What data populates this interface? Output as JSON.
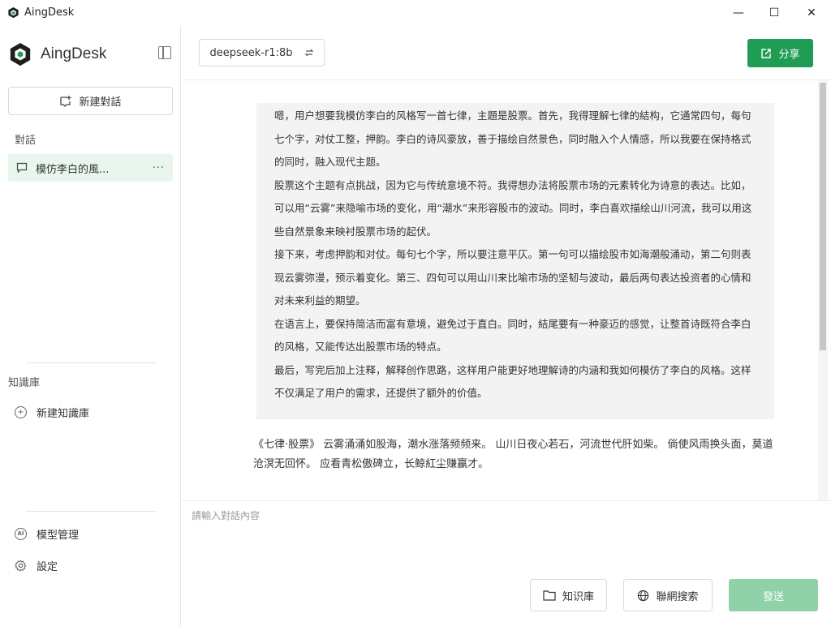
{
  "window": {
    "title": "AingDesk",
    "controls": {
      "minimize": "—",
      "maximize": "☐",
      "close": "✕"
    }
  },
  "sidebar": {
    "brand": "AingDesk",
    "new_chat_label": "新建對話",
    "conversations_label": "對話",
    "conversations": [
      {
        "label": "模仿李白的風...",
        "more": "···"
      }
    ],
    "knowledge_label": "知識庫",
    "new_knowledge_label": "新建知識庫",
    "model_management_label": "模型管理",
    "settings_label": "設定"
  },
  "header": {
    "model": "deepseek-r1:8b",
    "share_label": "分享"
  },
  "chat": {
    "thinking_paragraphs": [
      "嗯，用户想要我模仿李白的风格写一首七律，主題是股票。首先，我得理解七律的結构，它通常四句，每句七个字，对仗工整，押韵。李白的诗风豪放，善于描绘自然景色，同时融入个人情感，所以我要在保持格式的同时，融入现代主题。",
      "股票这个主题有点挑战，因为它与传统意境不符。我得想办法将股票市场的元素转化为诗意的表达。比如，可以用“云雾”来隐喻市场的变化，用“潮水”来形容股市的波动。同时，李白喜欢描绘山川河流，我可以用这些自然景象来映衬股票市场的起伏。",
      "接下来，考虑押韵和对仗。每句七个字，所以要注意平仄。第一句可以描绘股市如海潮般涌动，第二句则表现云雾弥漫，预示着变化。第三、四句可以用山川来比喻市场的坚韧与波动，最后两句表达投资者的心情和对未来利益的期望。",
      "在语言上，要保持简洁而富有意境，避免过于直白。同时，結尾要有一种豪迈的感觉，让整首诗既符合李白的风格，又能传达出股票市场的特点。",
      "最后，写完后加上注释，解释创作思路，这样用户能更好地理解诗的内涵和我如何模仿了李白的风格。这样不仅满足了用户的需求，还提供了额外的价值。"
    ],
    "answer": "《七律·股票》 云雾涌涌如股海，潮水涨落频频来。 山川日夜心若石，河流世代肝如柴。 倘使风雨换头面，莫道沧溟无回怀。 应看青松傲碑立，长鲸紅尘赚赢才。"
  },
  "input": {
    "placeholder": "請輸入對話內容",
    "knowledge_button": "知识庫",
    "web_search_button": "聯網搜索",
    "send_button": "發送"
  },
  "colors": {
    "accent": "#1f9d55",
    "accent_disabled": "#8fd1a8",
    "selected_bg": "#e8f6ee",
    "thinking_bg": "#f3f3f3"
  },
  "icons": {
    "app": "aingdesk-logo-icon",
    "collapse": "sidebar-collapse-icon",
    "new_chat": "new-chat-icon",
    "chat": "chat-bubble-icon",
    "add": "plus-circle-icon",
    "model": "ai-model-icon",
    "settings": "gear-icon",
    "swap": "swap-icon",
    "share": "share-icon",
    "folder": "folder-icon",
    "globe": "globe-icon"
  }
}
